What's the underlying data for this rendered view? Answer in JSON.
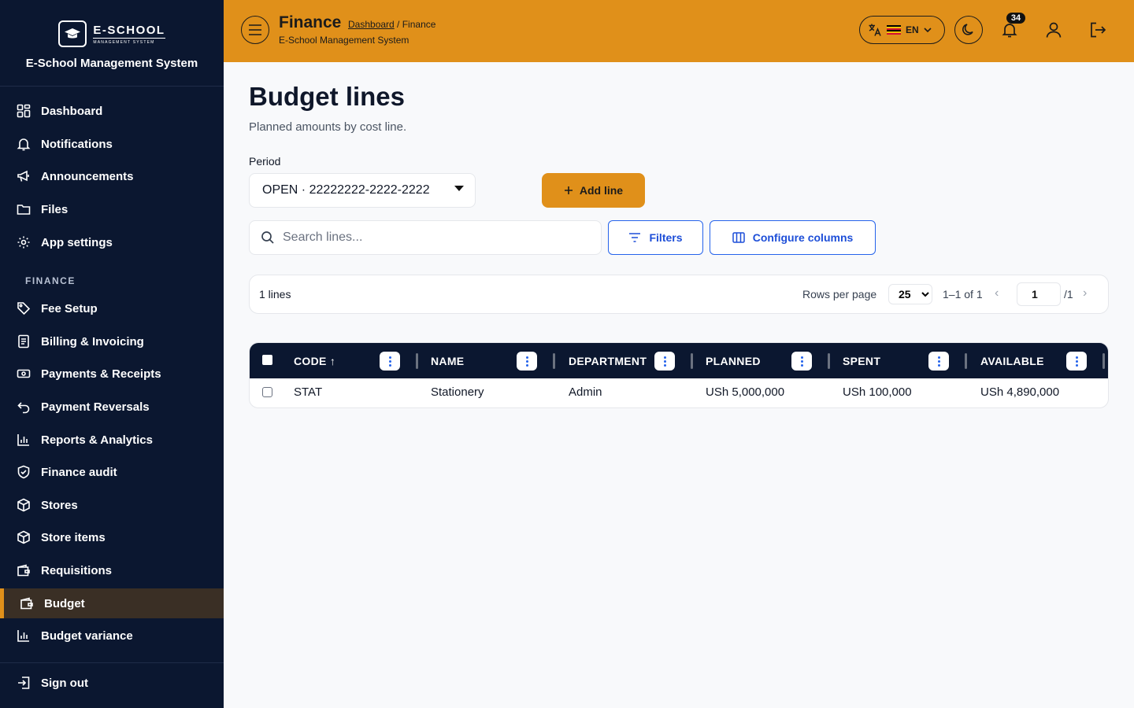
{
  "app": {
    "logo_name": "E-SCHOOL",
    "logo_sub": "MANAGEMENT SYSTEM",
    "system_title": "E-School Management System"
  },
  "sidebar": {
    "items": [
      {
        "label": "Dashboard",
        "icon": "grid-icon"
      },
      {
        "label": "Notifications",
        "icon": "bell-icon"
      },
      {
        "label": "Announcements",
        "icon": "megaphone-icon"
      },
      {
        "label": "Files",
        "icon": "folder-icon"
      },
      {
        "label": "App settings",
        "icon": "gear-icon"
      }
    ],
    "section_label": "FINANCE",
    "finance_items": [
      {
        "label": "Fee Setup",
        "icon": "tag-icon"
      },
      {
        "label": "Billing & Invoicing",
        "icon": "invoice-icon"
      },
      {
        "label": "Payments & Receipts",
        "icon": "cash-icon"
      },
      {
        "label": "Payment Reversals",
        "icon": "undo-icon"
      },
      {
        "label": "Reports & Analytics",
        "icon": "bar-chart-icon"
      },
      {
        "label": "Finance audit",
        "icon": "shield-check-icon"
      },
      {
        "label": "Stores",
        "icon": "box-icon"
      },
      {
        "label": "Store items",
        "icon": "box-icon"
      },
      {
        "label": "Requisitions",
        "icon": "wallet-icon"
      },
      {
        "label": "Budget",
        "icon": "wallet-icon",
        "active": true
      },
      {
        "label": "Budget variance",
        "icon": "bar-chart-icon"
      }
    ],
    "sign_out": "Sign out",
    "active_color": "#e0901a"
  },
  "header": {
    "title": "Finance",
    "breadcrumb_link": "Dashboard",
    "breadcrumb_current": " / Finance",
    "subtitle": "E-School Management System",
    "lang_code": "EN",
    "notification_count": "34",
    "bg_color": "#e0901a"
  },
  "main": {
    "title": "Budget lines",
    "subtitle": "Planned amounts by cost line.",
    "period_label": "Period",
    "period_value": "OPEN · 22222222-2222-2222",
    "add_label": "Add line",
    "search_placeholder": "Search lines...",
    "filters_label": "Filters",
    "configure_label": "Configure columns"
  },
  "pager": {
    "count": "1 lines",
    "rows_per_page_label": "Rows per page",
    "rows_per_page": "25",
    "range": "1–1 of 1",
    "page": "1",
    "total_pages": "/1"
  },
  "table": {
    "columns": [
      "CODE ↑",
      "NAME",
      "DEPARTMENT",
      "PLANNED",
      "SPENT",
      "AVAILABLE"
    ],
    "rows": [
      [
        "STAT",
        "Stationery",
        "Admin",
        "USh 5,000,000",
        "USh 100,000",
        "USh 4,890,000"
      ]
    ]
  }
}
